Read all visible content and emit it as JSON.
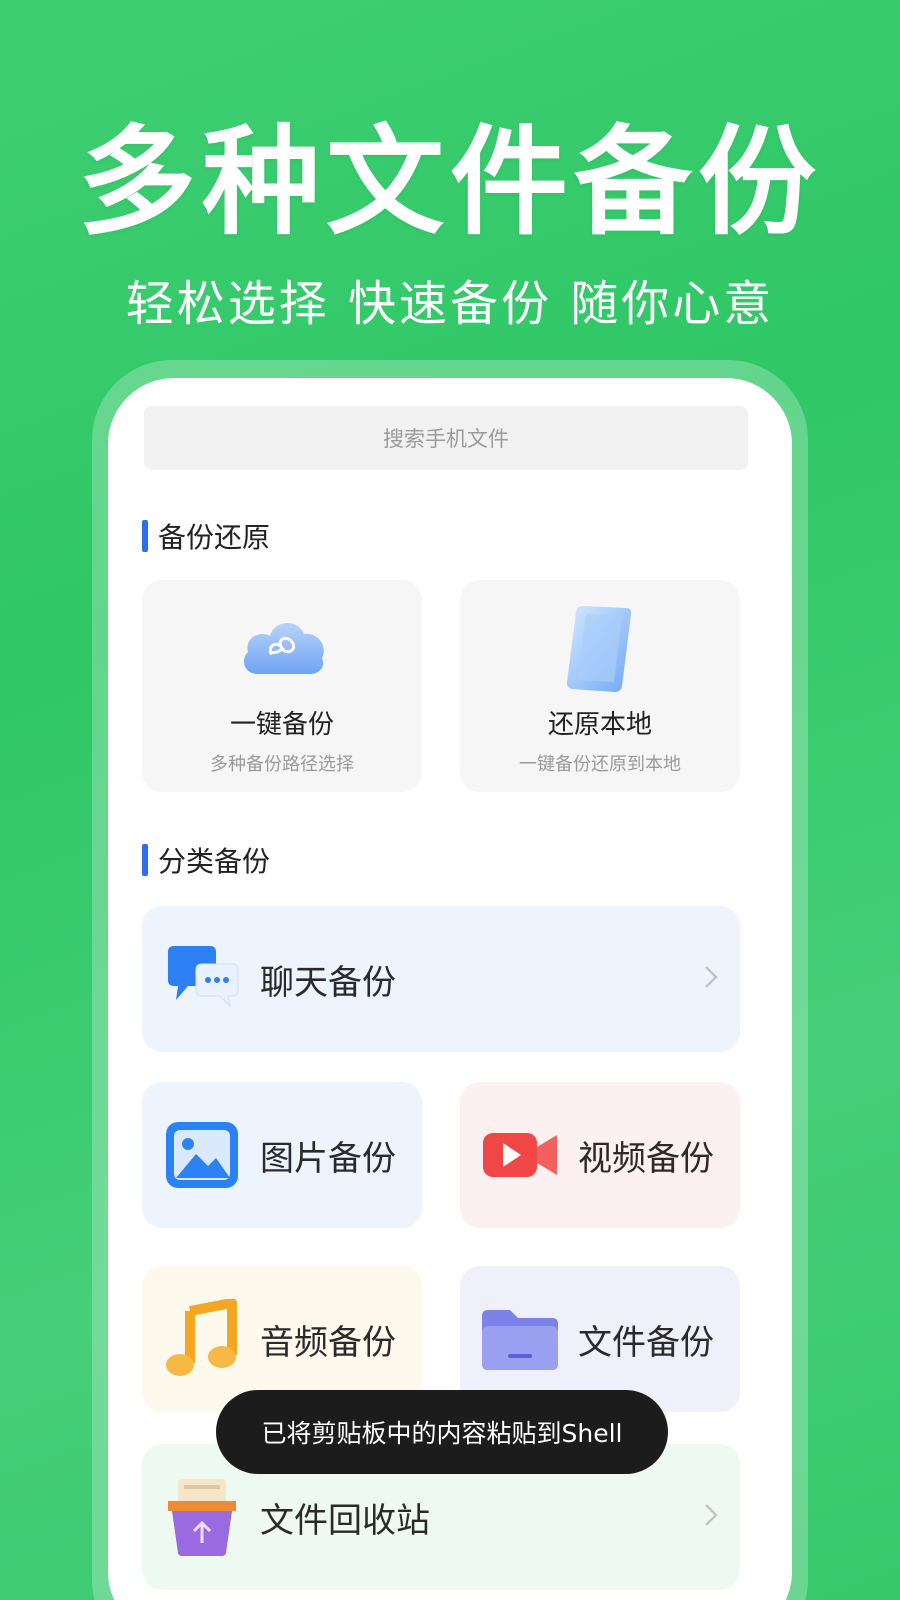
{
  "promo": {
    "title": "多种文件备份",
    "subtitle": "轻松选择 快速备份 随你心意"
  },
  "search": {
    "placeholder": "搜索手机文件"
  },
  "sections": {
    "backup_restore": {
      "title": "备份还原",
      "tiles": [
        {
          "title": "一键备份",
          "subtitle": "多种备份路径选择",
          "icon": "cloud-icon"
        },
        {
          "title": "还原本地",
          "subtitle": "一键备份还原到本地",
          "icon": "phone-icon"
        }
      ]
    },
    "category_backup": {
      "title": "分类备份",
      "items": [
        {
          "label": "聊天备份",
          "icon": "chat-icon",
          "bg": "#edf4fd"
        },
        {
          "label": "图片备份",
          "icon": "image-icon",
          "bg": "#edf4fd"
        },
        {
          "label": "视频备份",
          "icon": "video-icon",
          "bg": "#fdf0f0"
        },
        {
          "label": "音频备份",
          "icon": "music-icon",
          "bg": "#fdf9ec"
        },
        {
          "label": "文件备份",
          "icon": "folder-icon",
          "bg": "#f0f0fb"
        },
        {
          "label": "文件回收站",
          "icon": "recycle-bin-icon",
          "bg": "#eefaf1"
        }
      ]
    }
  },
  "toast": {
    "text": "已将剪贴板中的内容粘贴到Shell"
  },
  "colors": {
    "background_green": "#3fcf73",
    "accent_blue": "#2f6df0"
  }
}
